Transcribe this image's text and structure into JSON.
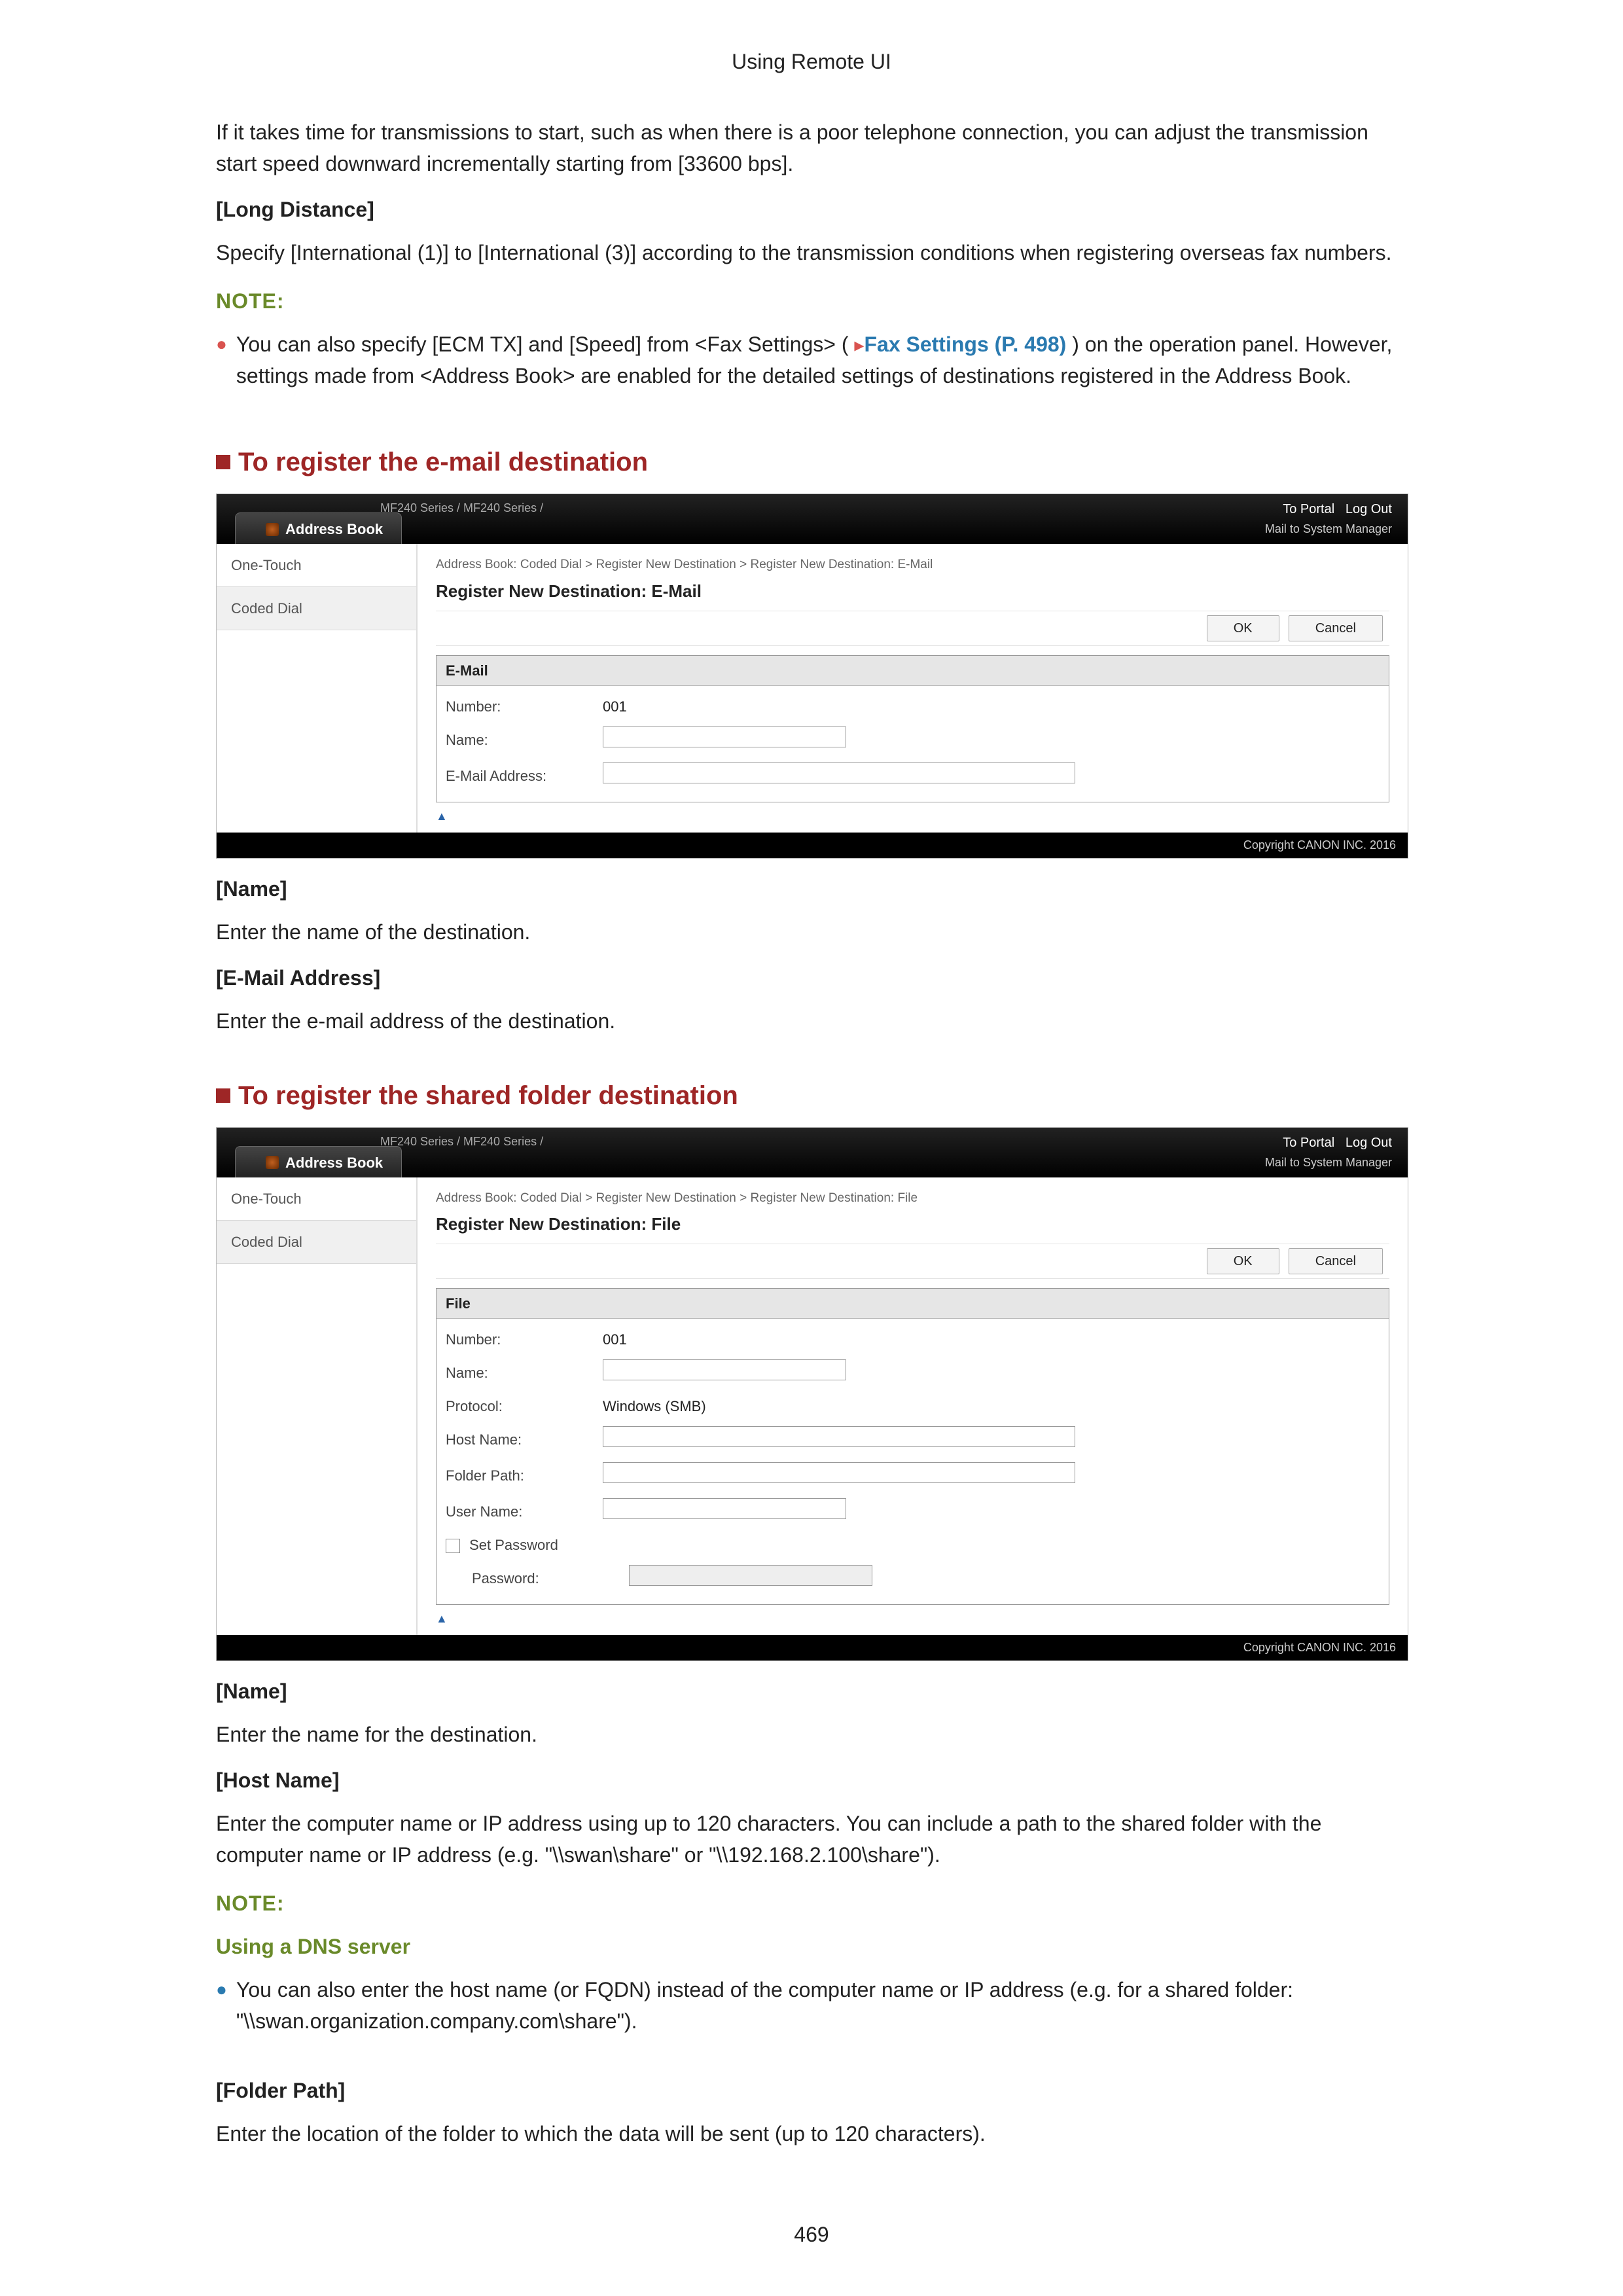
{
  "chapter": "Using Remote UI",
  "page_number": "469",
  "intro_para": "If it takes time for transmissions to start, such as when there is a poor telephone connection, you can adjust the transmission start speed downward incrementally starting from [33600 bps].",
  "long_distance_heading": "[Long Distance]",
  "long_distance_body": "Specify [International (1)] to [International (3)] according to the transmission conditions when registering overseas fax numbers.",
  "note_label": "NOTE:",
  "note1_pre": "You can also specify [ECM TX] and [Speed] from <Fax Settings> ( ",
  "note1_link": "Fax Settings (P. 498)",
  "note1_post": " ) on the operation panel. However, settings made from <Address Book> are enabled for the detailed settings of destinations registered in the Address Book.",
  "section_email_title": "To register the e-mail destination",
  "section_file_title": "To register the shared folder destination",
  "email_name_h": "[Name]",
  "email_name_b": "Enter the name of the destination.",
  "email_addr_h": "[E-Mail Address]",
  "email_addr_b": "Enter the e-mail address of the destination.",
  "file_name_h": "[Name]",
  "file_name_b": "Enter the name for the destination.",
  "file_host_h": "[Host Name]",
  "file_host_b": "Enter the computer name or IP address using up to 120 characters. You can include a path to the shared folder with the computer name or IP address (e.g. \"\\\\swan\\share\" or \"\\\\192.168.2.100\\share\").",
  "dns_h": "Using a DNS server",
  "dns_b": "You can also enter the host name (or FQDN) instead of the computer name or IP address (e.g. for a shared folder: \"\\\\swan.organization.company.com\\share\").",
  "folder_path_h": "[Folder Path]",
  "folder_path_b": "Enter the location of the folder to which the data will be sent (up to 120 characters).",
  "ss_common": {
    "model": "MF240 Series / MF240 Series /",
    "to_portal": "To Portal",
    "log_out": "Log Out",
    "mail_to": "Mail to System Manager",
    "tab": "Address Book",
    "side_one_touch": "One-Touch",
    "side_coded": "Coded Dial",
    "ok": "OK",
    "cancel": "Cancel",
    "top_arrow": "▲",
    "copyright": "Copyright CANON INC. 2016"
  },
  "ss_email": {
    "breadcrumb": "Address Book: Coded Dial > Register New Destination > Register New Destination: E-Mail",
    "heading": "Register New Destination: E-Mail",
    "panel_head": "E-Mail",
    "row_number_lbl": "Number:",
    "row_number_val": "001",
    "row_name_lbl": "Name:",
    "row_addr_lbl": "E-Mail Address:"
  },
  "ss_file": {
    "breadcrumb": "Address Book: Coded Dial > Register New Destination > Register New Destination: File",
    "heading": "Register New Destination: File",
    "panel_head": "File",
    "row_number_lbl": "Number:",
    "row_number_val": "001",
    "row_name_lbl": "Name:",
    "row_proto_lbl": "Protocol:",
    "row_proto_val": "Windows (SMB)",
    "row_host_lbl": "Host Name:",
    "row_folder_lbl": "Folder Path:",
    "row_user_lbl": "User Name:",
    "row_setpw_lbl": "Set Password",
    "row_pw_lbl": "Password:"
  }
}
